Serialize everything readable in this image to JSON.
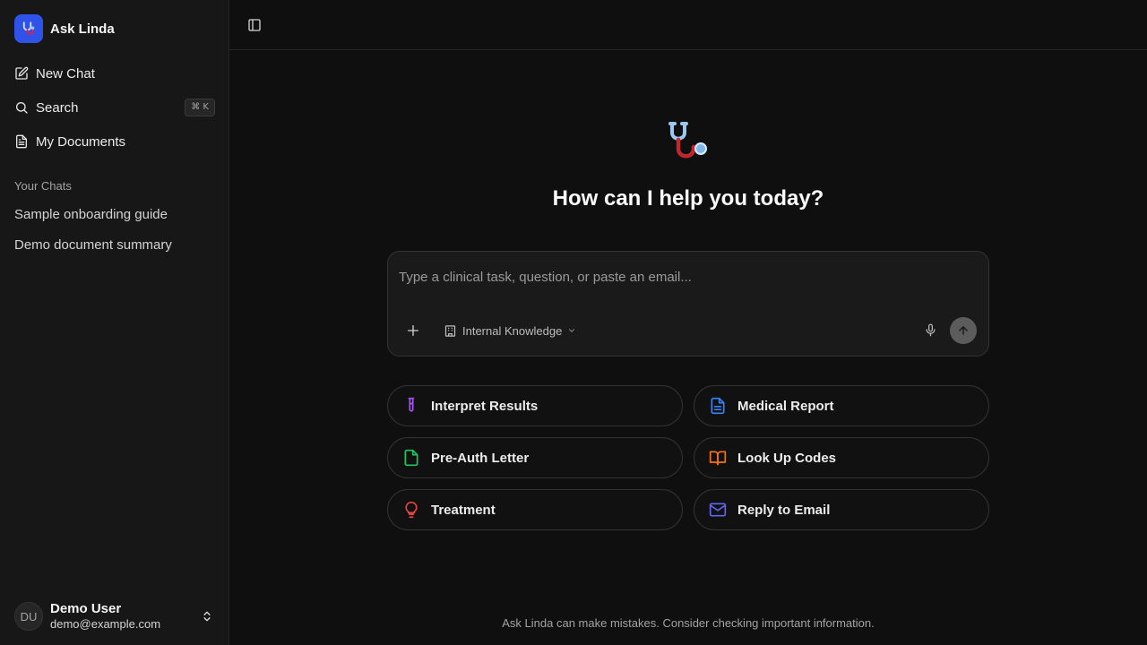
{
  "app": {
    "name": "Ask Linda"
  },
  "sidebar": {
    "nav": [
      {
        "label": "New Chat",
        "icon": "edit-icon"
      },
      {
        "label": "Search",
        "icon": "search-icon",
        "shortcut": "⌘ K"
      },
      {
        "label": "My Documents",
        "icon": "document-icon"
      }
    ],
    "section_title": "Your Chats",
    "chats": [
      {
        "label": "Sample onboarding guide"
      },
      {
        "label": "Demo document summary"
      }
    ],
    "user": {
      "initials": "DU",
      "name": "Demo User",
      "email": "demo@example.com"
    }
  },
  "main": {
    "headline": "How can I help you today?",
    "composer": {
      "placeholder": "Type a clinical task, question, or paste an email...",
      "source_label": "Internal Knowledge"
    },
    "suggestions": [
      {
        "label": "Interpret Results",
        "icon": "test-tube-icon",
        "color": "#a855f7"
      },
      {
        "label": "Medical Report",
        "icon": "file-text-icon",
        "color": "#3b82f6"
      },
      {
        "label": "Pre-Auth Letter",
        "icon": "file-icon",
        "color": "#22c55e"
      },
      {
        "label": "Look Up Codes",
        "icon": "book-open-icon",
        "color": "#f97316"
      },
      {
        "label": "Treatment",
        "icon": "lightbulb-icon",
        "color": "#ef4444"
      },
      {
        "label": "Reply to Email",
        "icon": "mail-icon",
        "color": "#6366f1"
      }
    ],
    "footer": "Ask Linda can make mistakes. Consider checking important information."
  }
}
